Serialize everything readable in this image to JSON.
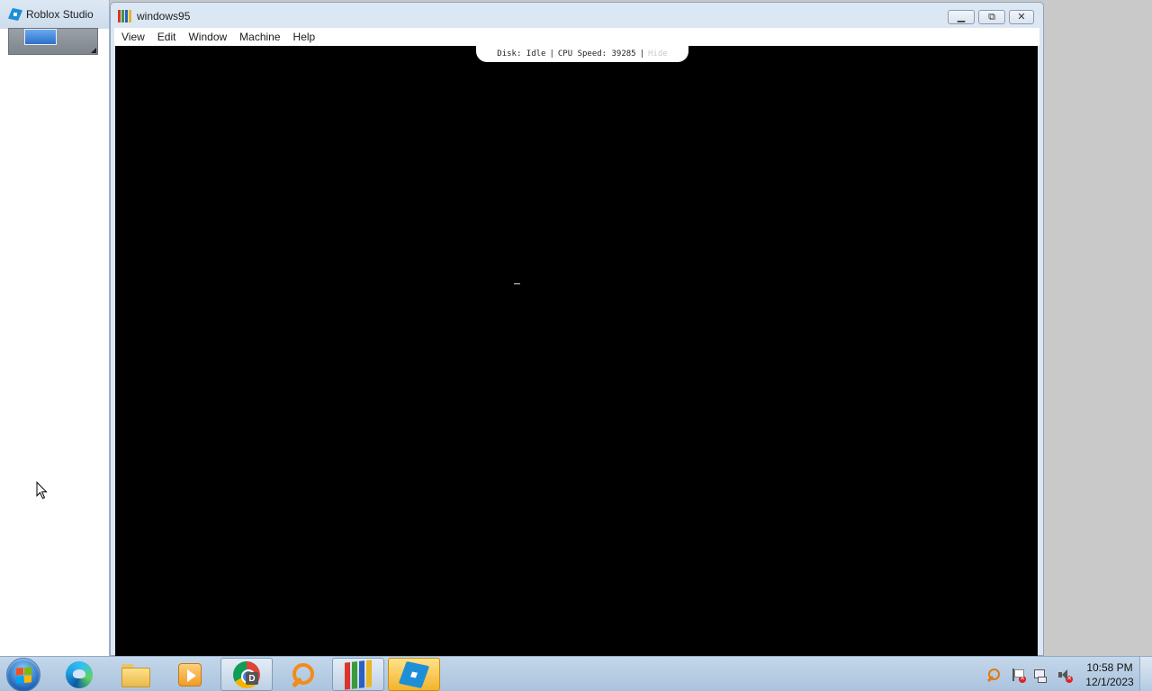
{
  "background_window": {
    "title": "Roblox Studio",
    "icon": "roblox-studio-icon"
  },
  "main_window": {
    "title": "windows95",
    "icon": "windows95-icon",
    "controls": {
      "minimize_icon": "minimize-icon",
      "restore_icon": "restore-icon",
      "close_icon": "close-icon"
    },
    "menu": [
      {
        "label": "View"
      },
      {
        "label": "Edit"
      },
      {
        "label": "Window"
      },
      {
        "label": "Machine"
      },
      {
        "label": "Help"
      }
    ],
    "status_bar": {
      "disk": "Disk: Idle",
      "separator": "|",
      "cpu": "CPU Speed: 39285",
      "hide": "Hide"
    },
    "screen_cursor": "_"
  },
  "taskbar": {
    "start_icon": "windows-start-orb-icon",
    "pinned": [
      {
        "name": "edge",
        "icon": "edge-icon"
      },
      {
        "name": "file-explorer",
        "icon": "folder-icon"
      },
      {
        "name": "media-player",
        "icon": "media-player-icon"
      },
      {
        "name": "chrome",
        "icon": "chrome-icon",
        "badge": "D"
      },
      {
        "name": "search",
        "icon": "search-icon"
      },
      {
        "name": "windows95",
        "icon": "windows95-icon"
      },
      {
        "name": "roblox-studio",
        "icon": "roblox-studio-icon"
      }
    ],
    "tray": {
      "icons": [
        "search-tray-icon",
        "action-center-flag-icon",
        "network-icon",
        "speaker-muted-icon"
      ],
      "time": "10:58 PM",
      "date": "12/1/2023"
    }
  },
  "colors": {
    "taskbar": "#aac3dd",
    "window_frame": "#dbe7f3",
    "screen": "#000000",
    "active_button": "#f3b42a",
    "w95_red": "#d9352b",
    "w95_green": "#3b9a3b",
    "w95_blue": "#2c5fbf",
    "w95_yellow": "#e8b524"
  }
}
